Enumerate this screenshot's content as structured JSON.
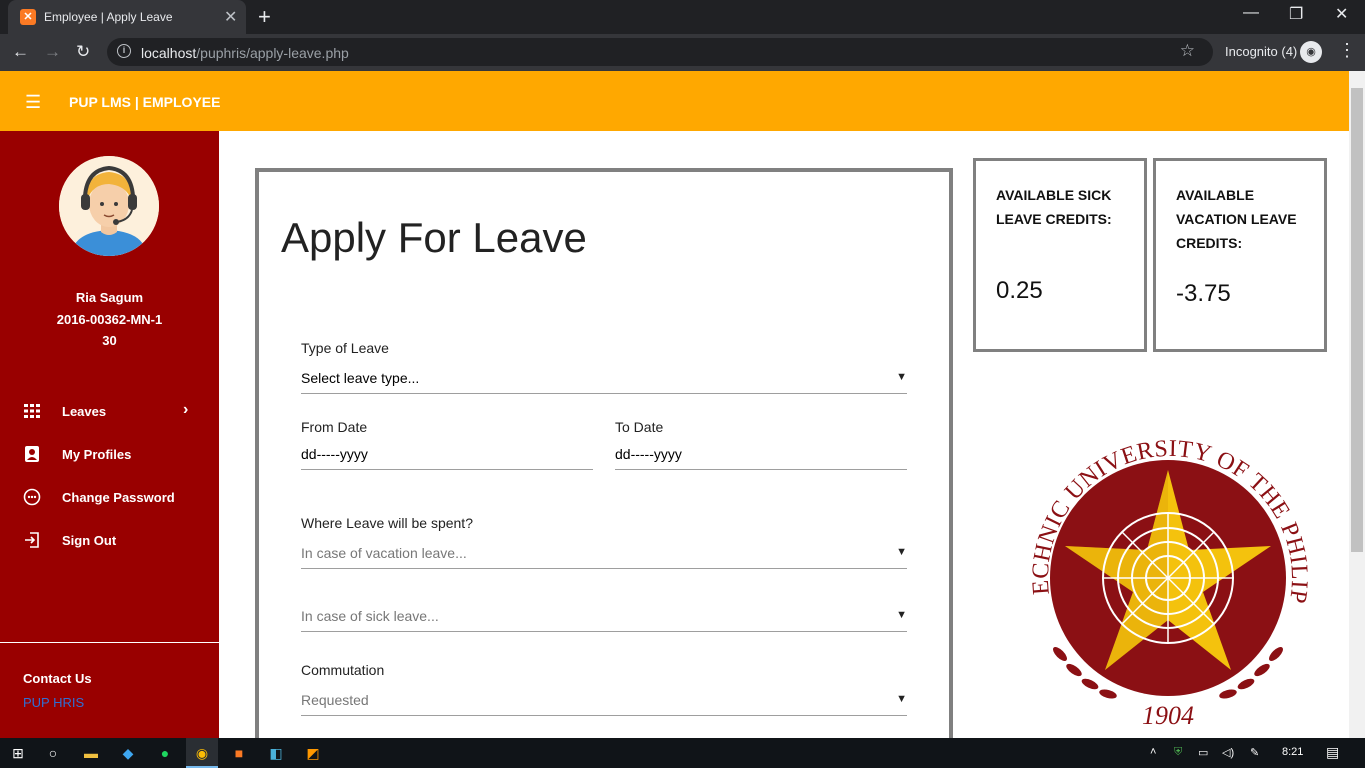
{
  "browser": {
    "tab_title": "Employee | Apply Leave",
    "url_host": "localhost",
    "url_path": "/puphris/apply-leave.php",
    "incognito_label": "Incognito (4)"
  },
  "app": {
    "brand": "PUP LMS | EMPLOYEE",
    "header_color": "#ffa800",
    "sidebar_color": "#990000"
  },
  "user": {
    "name": "Ria Sagum",
    "id": "2016-00362-MN-1",
    "number": "30"
  },
  "sidebar": {
    "items": [
      {
        "label": "Leaves",
        "icon": "grid-icon"
      },
      {
        "label": "My Profiles",
        "icon": "profile-icon"
      },
      {
        "label": "Change Password",
        "icon": "password-icon"
      },
      {
        "label": "Sign Out",
        "icon": "sign-out-icon"
      }
    ],
    "contact": "Contact Us",
    "link": "PUP HRIS"
  },
  "form": {
    "title": "Apply For Leave",
    "type_label": "Type of Leave",
    "type_value": "Select leave type...",
    "from_label": "From Date",
    "from_value": "dd-----yyyy",
    "to_label": "To Date",
    "to_value": "dd-----yyyy",
    "where_label": "Where Leave will be spent?",
    "vacation_value": "In case of vacation leave...",
    "sick_value": "In case of sick leave...",
    "commutation_label": "Commutation",
    "commutation_value": "Requested"
  },
  "credits": {
    "sick_title": "AVAILABLE SICK LEAVE CREDITS:",
    "sick_value": "0.25",
    "vacation_title": "AVAILABLE VACATION LEAVE CREDITS:",
    "vacation_value": "-3.75"
  },
  "seal": {
    "text": "POLYTECHNIC UNIVERSITY OF THE PHILIPPINES",
    "year": "1904"
  },
  "taskbar": {
    "clock": "8:21"
  }
}
